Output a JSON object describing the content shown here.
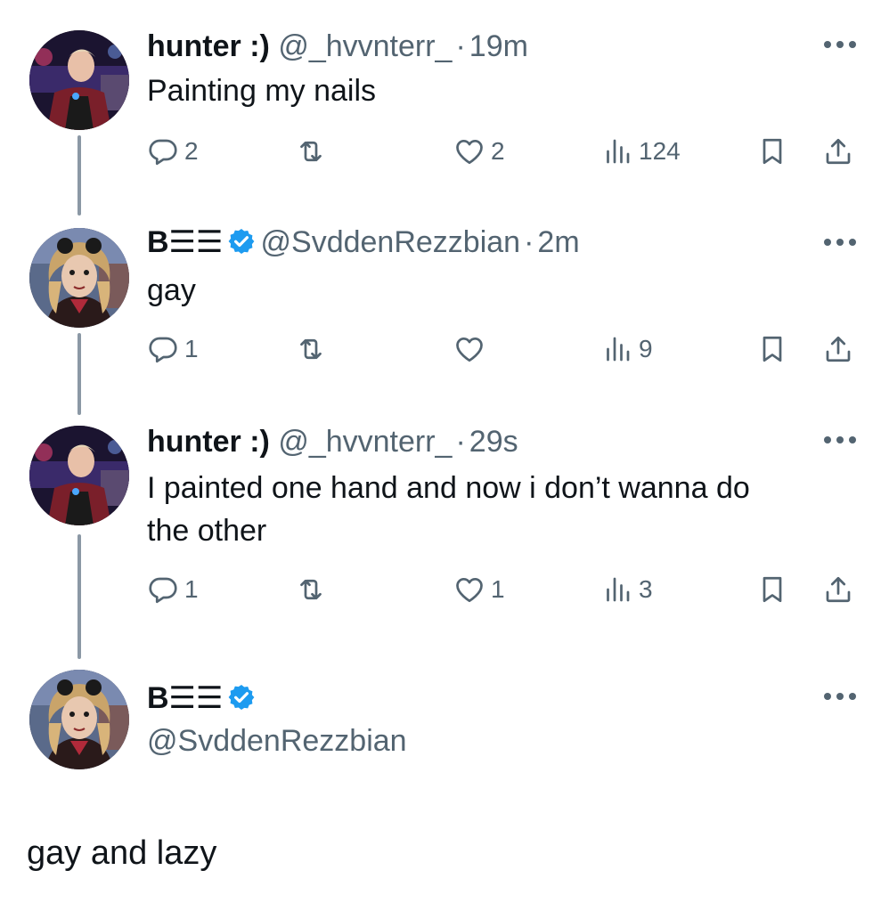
{
  "thread": [
    {
      "name": "hunter :)",
      "handle": "@_hvvnterr_",
      "time": "19m",
      "text_lines": [
        "Painting my nails"
      ],
      "replies": "2",
      "reposts": "",
      "likes": "2",
      "views": "124",
      "avatar": "avatar-hunter"
    },
    {
      "name": "B☰☰",
      "handle": "@SvddenRezzbian",
      "time": "2m",
      "verified": true,
      "text_lines": [
        "gay"
      ],
      "replies": "1",
      "reposts": "",
      "likes": "",
      "views": "9",
      "avatar": "avatar-bee"
    },
    {
      "name": "hunter :)",
      "handle": "@_hvvnterr_",
      "time": "29s",
      "text_lines": [
        "I painted one hand and now i don’t wanna do",
        "the other"
      ],
      "replies": "1",
      "reposts": "",
      "likes": "1",
      "views": "3",
      "avatar": "avatar-hunter"
    }
  ],
  "focused": {
    "name": "B☰☰",
    "handle": "@SvddenRezzbian",
    "verified": true,
    "text": "gay and lazy"
  },
  "separator": "·",
  "colors": {
    "text": "#0f1419",
    "secondary": "#536471",
    "thread_line": "#8b98a5",
    "verified": "#1d9bf0"
  },
  "icons": [
    "reply-icon",
    "repost-icon",
    "like-icon",
    "views-icon",
    "bookmark-icon",
    "share-icon",
    "more-icon",
    "verified-badge-icon"
  ]
}
